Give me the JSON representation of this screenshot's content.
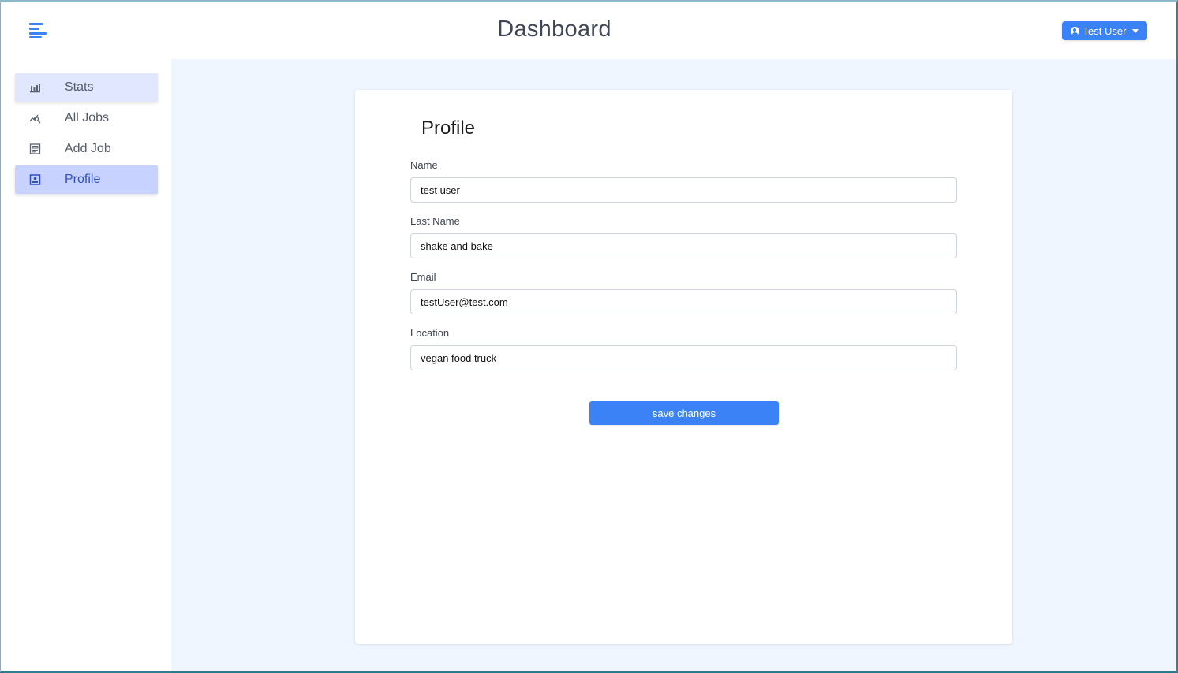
{
  "header": {
    "title": "Dashboard",
    "user_button_label": "Test User"
  },
  "sidebar": {
    "items": [
      {
        "label": "Stats",
        "icon": "bar-chart-icon"
      },
      {
        "label": "All Jobs",
        "icon": "query-stats-icon"
      },
      {
        "label": "Add Job",
        "icon": "form-icon"
      },
      {
        "label": "Profile",
        "icon": "profile-card-icon"
      }
    ],
    "active": "Profile"
  },
  "profile": {
    "title": "Profile",
    "fields": [
      {
        "label": "Name",
        "value": "test user"
      },
      {
        "label": "Last Name",
        "value": "shake and bake"
      },
      {
        "label": "Email",
        "value": "testUser@test.com"
      },
      {
        "label": "Location",
        "value": "vegan food truck"
      }
    ],
    "save_label": "save changes"
  },
  "colors": {
    "accent": "#3b82f6",
    "main_background": "#f0f6ff",
    "active_nav": "#c7d2fe",
    "hover_nav": "#e0e7ff"
  }
}
